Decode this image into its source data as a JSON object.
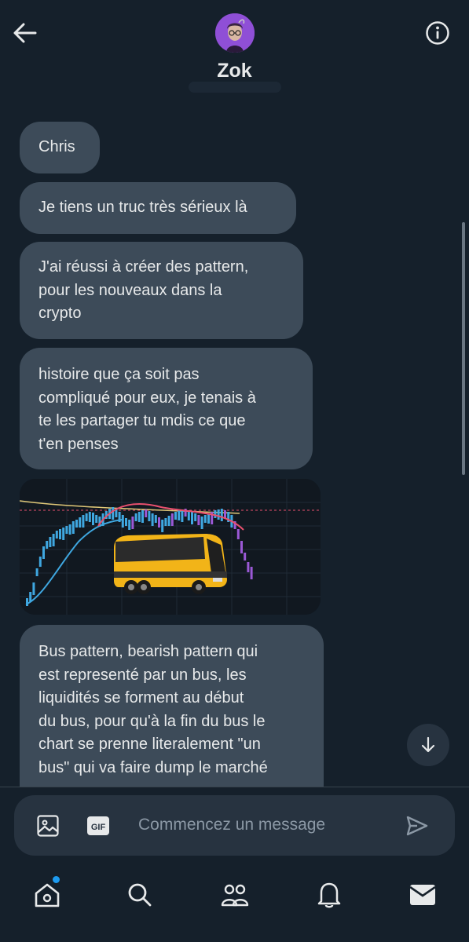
{
  "header": {
    "contact_name": "Zok",
    "back_icon": "arrow-left-icon",
    "info_icon": "info-icon"
  },
  "messages": [
    {
      "text": "Chris"
    },
    {
      "text": "Je tiens un truc très sérieux là"
    },
    {
      "text": "J'ai réussi à créer des pattern,\npour les nouveaux dans la\ncrypto"
    },
    {
      "text": "histoire que ça soit pas\ncompliqué pour eux, je tenais à\nte les partager tu mdis ce que\nt'en penses"
    },
    {
      "text": "Bus pattern, bearish pattern qui\nest representé par un bus, les\nliquidités se forment au début\ndu bus, pour qu'à la fin du bus le\nchart se prenne literalement \"un\nbus\" qui va faire dump le marché"
    }
  ],
  "media": {
    "description_icon": "image-icon"
  },
  "composer": {
    "placeholder": "Commencez un message",
    "value": ""
  },
  "nav": {
    "items": [
      "home-icon",
      "search-icon",
      "communities-icon",
      "notifications-icon",
      "messages-icon"
    ]
  },
  "colors": {
    "background": "#15202b",
    "bubble": "#3d4b59",
    "accent": "#1d9bf0",
    "text": "#e7e9ea",
    "muted": "#8b98a5"
  }
}
